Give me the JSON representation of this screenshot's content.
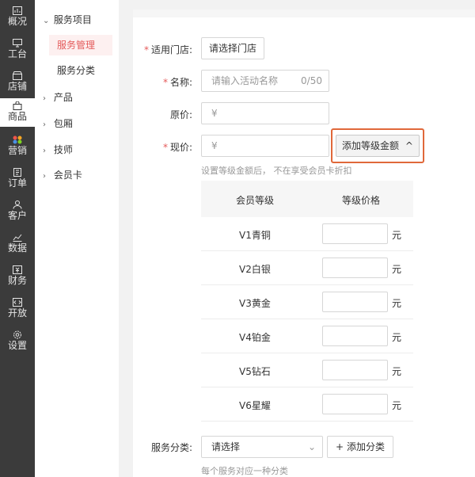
{
  "rail": {
    "items": [
      {
        "label": "概况",
        "icon": "overview-icon"
      },
      {
        "label": "工台",
        "icon": "desktop-icon"
      },
      {
        "label": "店铺",
        "icon": "store-icon"
      },
      {
        "label": "商品",
        "icon": "bag-icon"
      },
      {
        "label": "营销",
        "icon": "marketing-icon"
      },
      {
        "label": "订单",
        "icon": "order-icon"
      },
      {
        "label": "客户",
        "icon": "customer-icon"
      },
      {
        "label": "数据",
        "icon": "chart-icon"
      },
      {
        "label": "财务",
        "icon": "finance-icon"
      },
      {
        "label": "开放",
        "icon": "code-icon"
      },
      {
        "label": "设置",
        "icon": "gear-icon"
      }
    ],
    "active_index": 3
  },
  "sidebar": {
    "group_service": "服务项目",
    "item_manage": "服务管理",
    "item_category": "服务分类",
    "group_product": "产品",
    "group_room": "包厢",
    "group_tech": "技师",
    "group_card": "会员卡"
  },
  "form": {
    "store_label": "适用门店:",
    "store_button": "请选择门店",
    "name_label": "名称:",
    "name_placeholder": "请输入活动名称",
    "name_count": "0/50",
    "original_label": "原价:",
    "current_label": "现价:",
    "currency_symbol": "¥",
    "add_level_button": "添加等级金额",
    "add_level_chevron": "^",
    "level_hint": "设置等级金额后， 不在享受会员卡折扣",
    "category_label": "服务分类:",
    "category_select": "请选择",
    "add_category_button": "添加分类",
    "add_category_plus": "+",
    "category_hint": "每个服务对应一种分类"
  },
  "table": {
    "col_level": "会员等级",
    "col_price": "等级价格",
    "unit": "元",
    "rows": [
      {
        "level": "V1青铜"
      },
      {
        "level": "V2白银"
      },
      {
        "level": "V3黄金"
      },
      {
        "level": "V4铂金"
      },
      {
        "level": "V5钻石"
      },
      {
        "level": "V6星耀"
      }
    ]
  },
  "colors": {
    "accent": "#e45a5a",
    "highlight": "#e0683a",
    "rail": "#3b3b3b"
  }
}
